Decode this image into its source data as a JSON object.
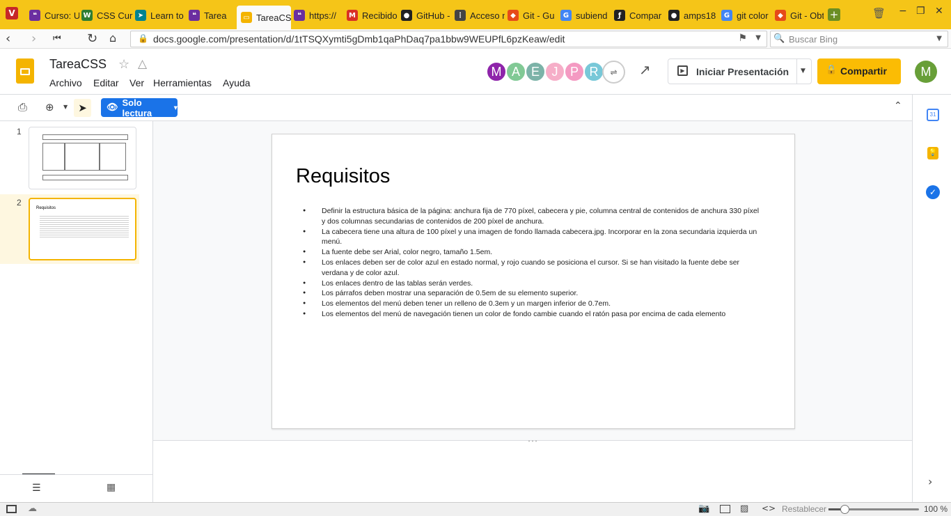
{
  "browser": {
    "tabs": [
      {
        "label": "Curso: U",
        "icon": "purple-book",
        "color": "#6b2ea0"
      },
      {
        "label": "CSS Curr",
        "icon": "w3-schools",
        "color": "#2e7d32"
      },
      {
        "label": "Learn to",
        "icon": "fish",
        "color": "#00838f"
      },
      {
        "label": "Tarea",
        "icon": "purple-book",
        "color": "#6b2ea0"
      },
      {
        "label": "TareaCS",
        "icon": "slides",
        "color": "#f4b400"
      },
      {
        "label": "https://",
        "icon": "purple-book",
        "color": "#6b2ea0"
      },
      {
        "label": "Recibido",
        "icon": "gmail",
        "color": "#d93025"
      },
      {
        "label": "GitHub -",
        "icon": "github",
        "color": "#222222"
      },
      {
        "label": "Acceso n",
        "icon": "grid",
        "color": "#444444"
      },
      {
        "label": "Git - Gu",
        "icon": "git",
        "color": "#e64a19"
      },
      {
        "label": "subiend",
        "icon": "google",
        "color": "#4285f4"
      },
      {
        "label": "Compar",
        "icon": "symfony",
        "color": "#222222"
      },
      {
        "label": "amps18",
        "icon": "github",
        "color": "#222222"
      },
      {
        "label": "git color",
        "icon": "google",
        "color": "#4285f4"
      },
      {
        "label": "Git - Obt",
        "icon": "git",
        "color": "#e64a19"
      }
    ],
    "url": "docs.google.com/presentation/d/1tTSQXymti5gDmb1qaPhDaq7pa1bbw9WEUPfL6pzKeaw/edit",
    "search_placeholder": "Buscar Bing"
  },
  "app": {
    "title": "TareaCSS",
    "menus": [
      "Archivo",
      "Editar",
      "Ver",
      "Herramientas",
      "Ayuda"
    ],
    "collaborators": [
      {
        "letter": "M",
        "color": "#8e24aa"
      },
      {
        "letter": "A",
        "color": "#81c995"
      },
      {
        "letter": "E",
        "color": "#7cb3a8"
      },
      {
        "letter": "J",
        "color": "#f6aec8"
      },
      {
        "letter": "P",
        "color": "#f49ac2"
      },
      {
        "letter": "R",
        "color": "#78c8d8"
      }
    ],
    "present_label": "Iniciar Presentación",
    "share_label": "Compartir",
    "user_initial": "M",
    "user_color": "#689f38",
    "accent": "#fbbc04"
  },
  "toolbar": {
    "readonly_label": "Solo lectura"
  },
  "filmstrip": {
    "slides": [
      {
        "number": "1"
      },
      {
        "number": "2",
        "title": "Requisitos"
      }
    ]
  },
  "slide": {
    "title": "Requisitos",
    "bullets": [
      "Definir la estructura básica de la página: anchura fija de 770 píxel,  cabecera y pie, columna central de contenidos de anchura 330 píxel y dos columnas secundarias de contenidos de 200 píxel de anchura.",
      " La cabecera tiene una altura de 100 píxel y una imagen de fondo llamada cabecera.jpg. Incorporar en la zona secundaria izquierda un menú.",
      "La fuente debe ser Arial, color negro, tamaño 1.5em.",
      "Los enlaces deben ser de color azul en estado normal, y rojo cuando se posiciona el cursor. Si se han visitado la fuente debe ser verdana y de color azul.",
      "Los enlaces dentro de las tablas serán verdes.",
      "Los párrafos deben mostrar una separación de 0.5em de su elemento superior.",
      "Los elementos del menú deben tener un relleno de 0.3em y un margen inferior de 0.7em.",
      "Los elementos del menú de navegación tienen un color de fondo cambie cuando el ratón pasa por encima de cada elemento"
    ]
  },
  "statusbar": {
    "reset_label": "Restablecer",
    "zoom": "100 %",
    "zoom_fraction": 0.18
  }
}
